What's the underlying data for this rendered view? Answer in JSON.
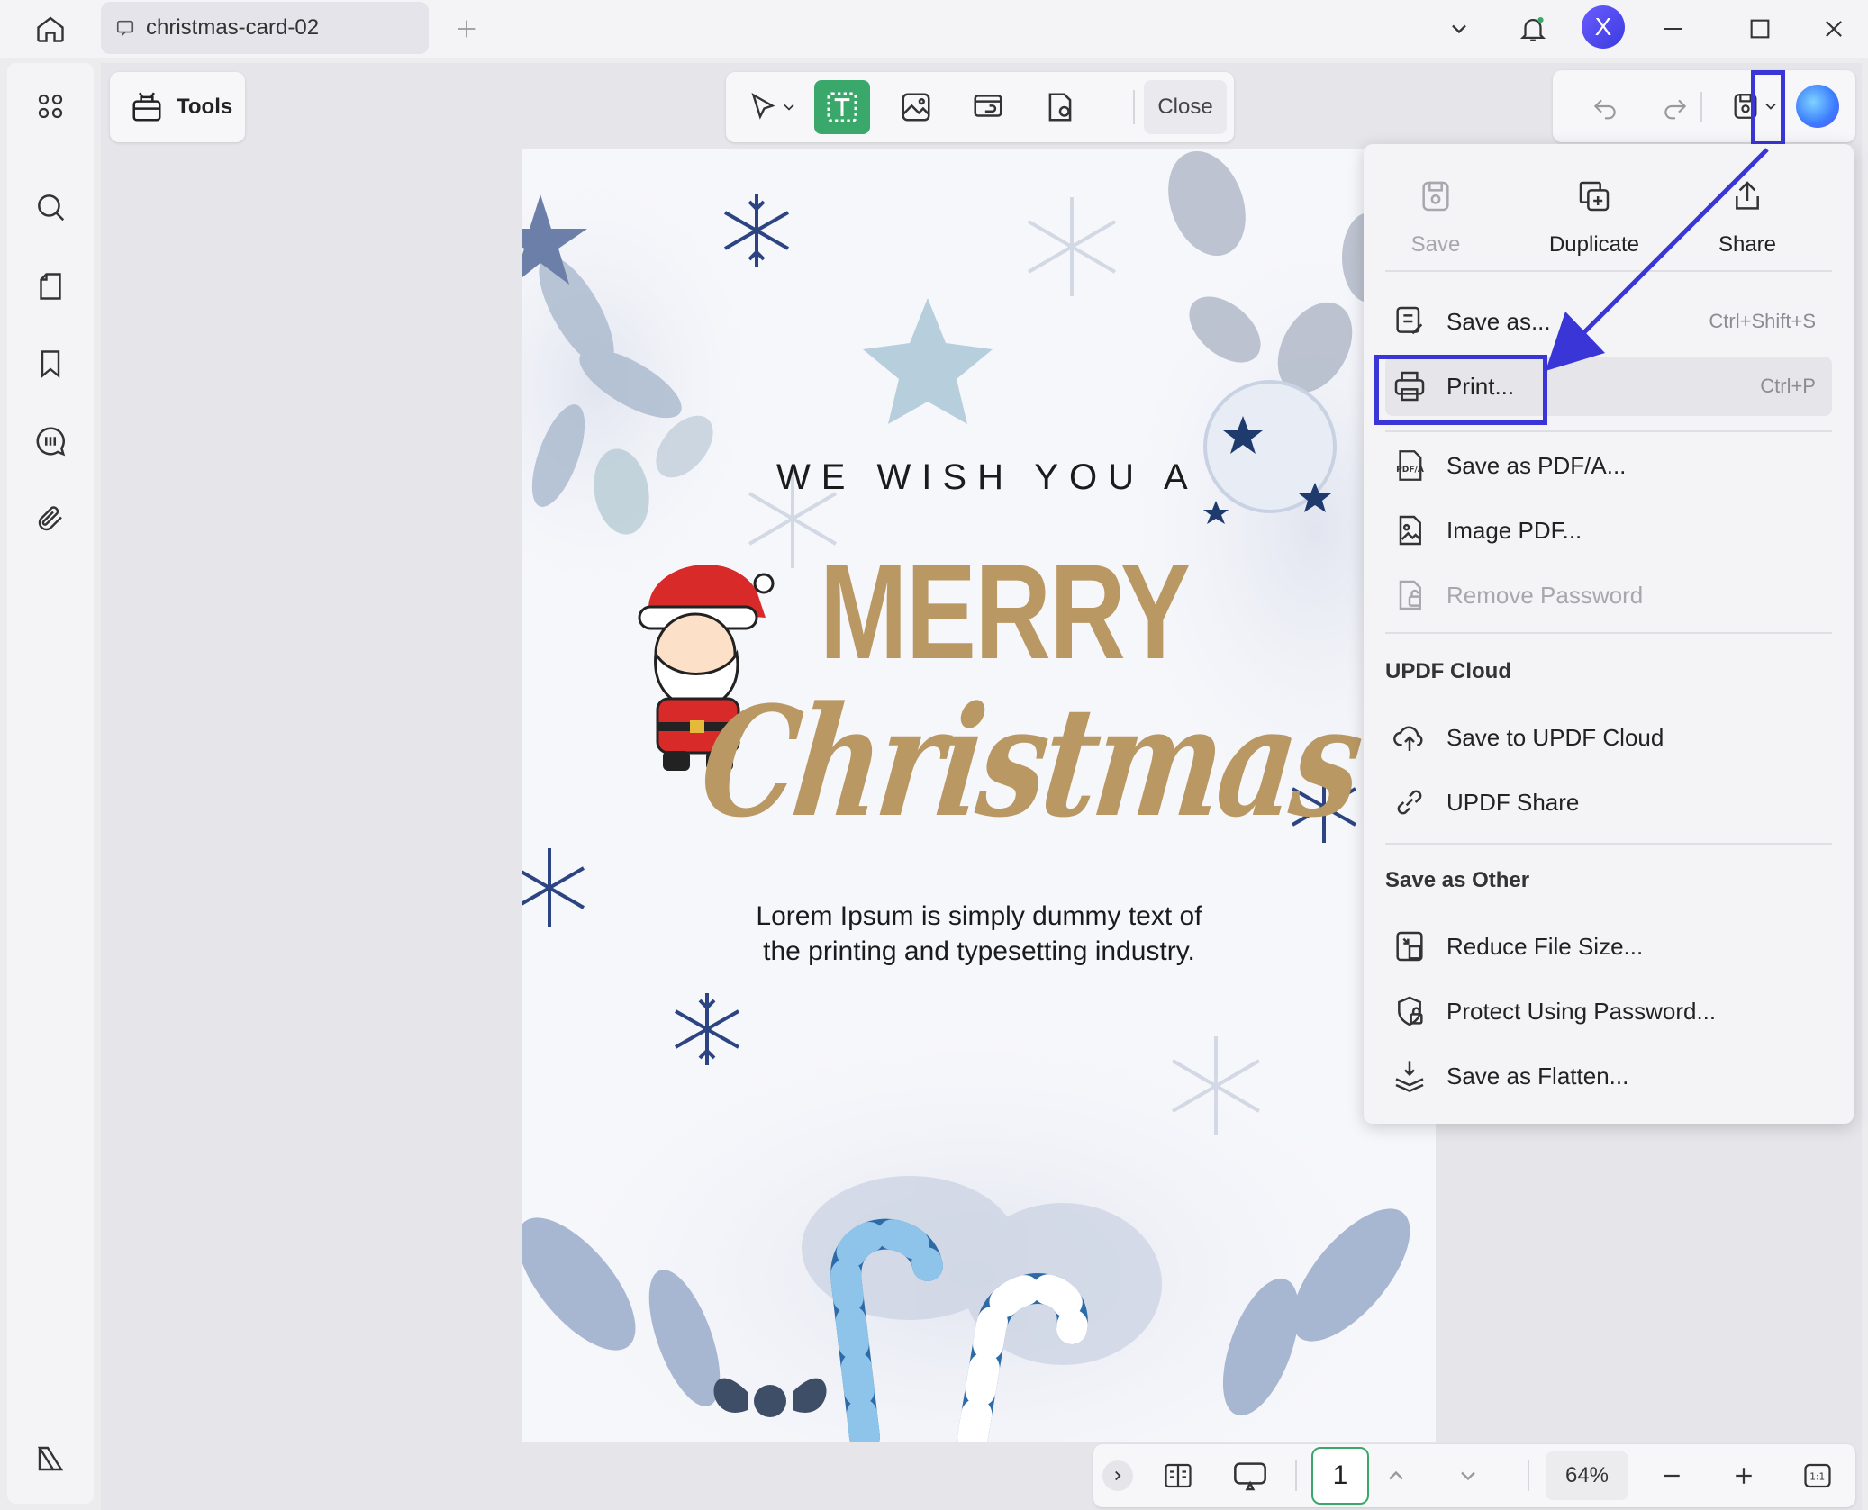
{
  "tab": {
    "title": "christmas-card-02"
  },
  "user": {
    "avatar_letter": "X"
  },
  "toolbar": {
    "tools_label": "Tools",
    "close_label": "Close"
  },
  "card": {
    "line1": "WE WISH YOU A",
    "line2": "MERRY",
    "line3": "Christmas",
    "body": "Lorem Ipsum is simply dummy text of the printing and typesetting industry."
  },
  "menu": {
    "top": [
      {
        "label": "Save",
        "icon": "save-icon",
        "disabled": true
      },
      {
        "label": "Duplicate",
        "icon": "duplicate-icon",
        "disabled": false
      },
      {
        "label": "Share",
        "icon": "share-icon",
        "disabled": false
      }
    ],
    "items": {
      "save_as": {
        "label": "Save as...",
        "shortcut": "Ctrl+Shift+S"
      },
      "print": {
        "label": "Print...",
        "shortcut": "Ctrl+P"
      },
      "save_pdfa": {
        "label": "Save as PDF/A..."
      },
      "image_pdf": {
        "label": "Image PDF..."
      },
      "remove_password": {
        "label": "Remove Password"
      }
    },
    "cloud_section": "UPDF Cloud",
    "cloud": {
      "save_cloud": {
        "label": "Save to UPDF Cloud"
      },
      "share": {
        "label": "UPDF Share"
      }
    },
    "other_section": "Save as Other",
    "other": {
      "reduce": {
        "label": "Reduce File Size..."
      },
      "protect": {
        "label": "Protect Using Password..."
      },
      "flatten": {
        "label": "Save as Flatten..."
      }
    }
  },
  "bottom": {
    "page": "1",
    "zoom": "64%"
  },
  "colors": {
    "accent_green": "#3aa86b",
    "highlight": "#3a35d6",
    "gold": "#b99863"
  }
}
